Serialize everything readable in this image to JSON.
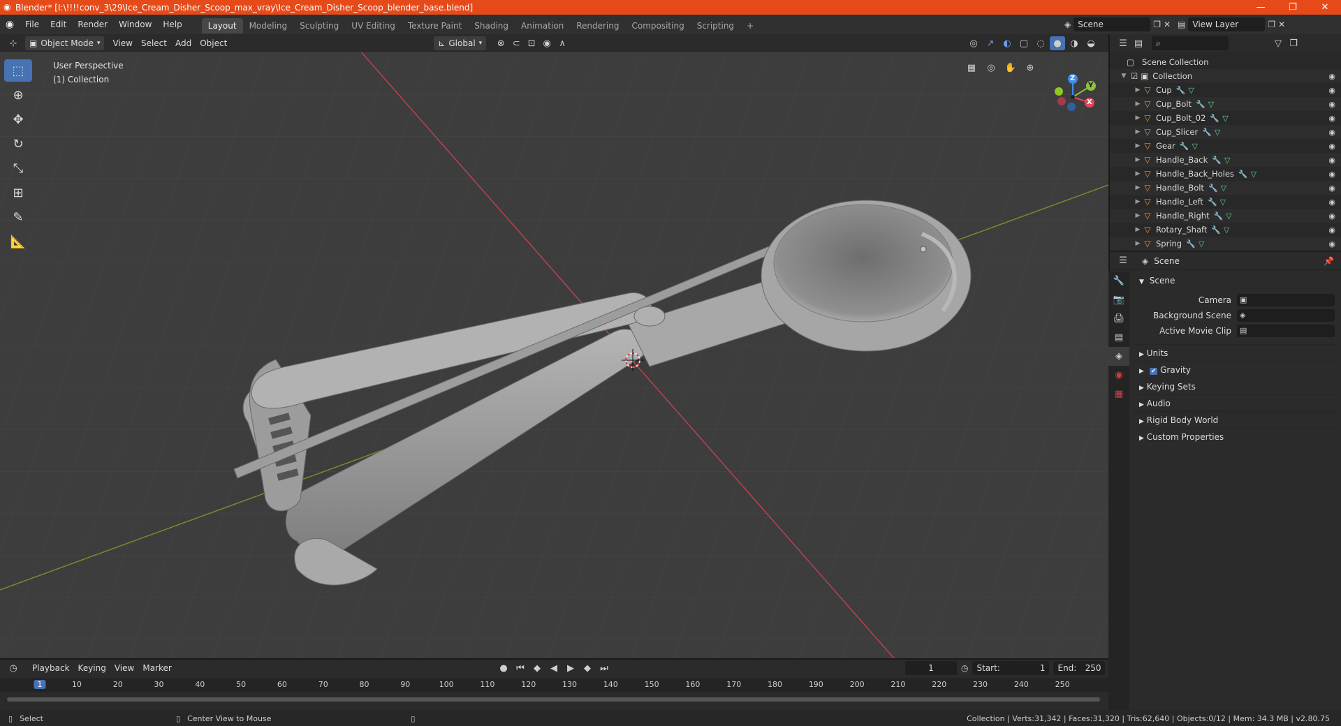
{
  "window": {
    "title": "Blender* [I:\\!!!!conv_3\\29\\Ice_Cream_Disher_Scoop_max_vray\\Ice_Cream_Disher_Scoop_blender_base.blend]",
    "minimize": "—",
    "maximize": "❐",
    "close": "✕"
  },
  "menu": [
    "File",
    "Edit",
    "Render",
    "Window",
    "Help"
  ],
  "workspaces": [
    "Layout",
    "Modeling",
    "Sculpting",
    "UV Editing",
    "Texture Paint",
    "Shading",
    "Animation",
    "Rendering",
    "Compositing",
    "Scripting"
  ],
  "active_workspace": "Layout",
  "scene_field": "Scene",
  "view_layer_field": "View Layer",
  "viewport_header": {
    "mode": "Object Mode",
    "menus": [
      "View",
      "Select",
      "Add",
      "Object"
    ],
    "orientation": "Global"
  },
  "viewport": {
    "perspective": "User Perspective",
    "collection": "(1) Collection",
    "axes": {
      "x": "X",
      "y": "Y",
      "z": "Z"
    }
  },
  "outliner": {
    "root": "Scene Collection",
    "collection": "Collection",
    "objects": [
      "Cup",
      "Cup_Bolt",
      "Cup_Bolt_02",
      "Cup_Slicer",
      "Gear",
      "Handle_Back",
      "Handle_Back_Holes",
      "Handle_Bolt",
      "Handle_Left",
      "Handle_Right",
      "Rotary_Shaft",
      "Spring"
    ]
  },
  "properties": {
    "context": "Scene",
    "panel": "Scene",
    "fields": [
      {
        "label": "Camera",
        "value": ""
      },
      {
        "label": "Background Scene",
        "value": ""
      },
      {
        "label": "Active Movie Clip",
        "value": ""
      }
    ],
    "subpanels": [
      "Units",
      "Gravity",
      "Keying Sets",
      "Audio",
      "Rigid Body World",
      "Custom Properties"
    ],
    "gravity_checked": true
  },
  "timeline": {
    "menus": [
      "Playback",
      "Keying",
      "View",
      "Marker"
    ],
    "current_frame": "1",
    "start_label": "Start:",
    "start": "1",
    "end_label": "End:",
    "end": "250",
    "ticks": [
      "1",
      "10",
      "20",
      "30",
      "40",
      "50",
      "60",
      "70",
      "80",
      "90",
      "100",
      "110",
      "120",
      "130",
      "140",
      "150",
      "160",
      "170",
      "180",
      "190",
      "200",
      "210",
      "220",
      "230",
      "240",
      "250"
    ]
  },
  "status": {
    "left": "Select",
    "middle": "Center View to Mouse",
    "stats": "Collection | Verts:31,342 | Faces:31,320 | Tris:62,640 | Objects:0/12 | Mem: 34.3 MB | v2.80.75"
  },
  "colors": {
    "titlebar": "#e64a19",
    "accent": "#4772b3",
    "x_axis": "#e8435a",
    "y_axis": "#8bc13c",
    "z_axis": "#3d8ce6"
  }
}
